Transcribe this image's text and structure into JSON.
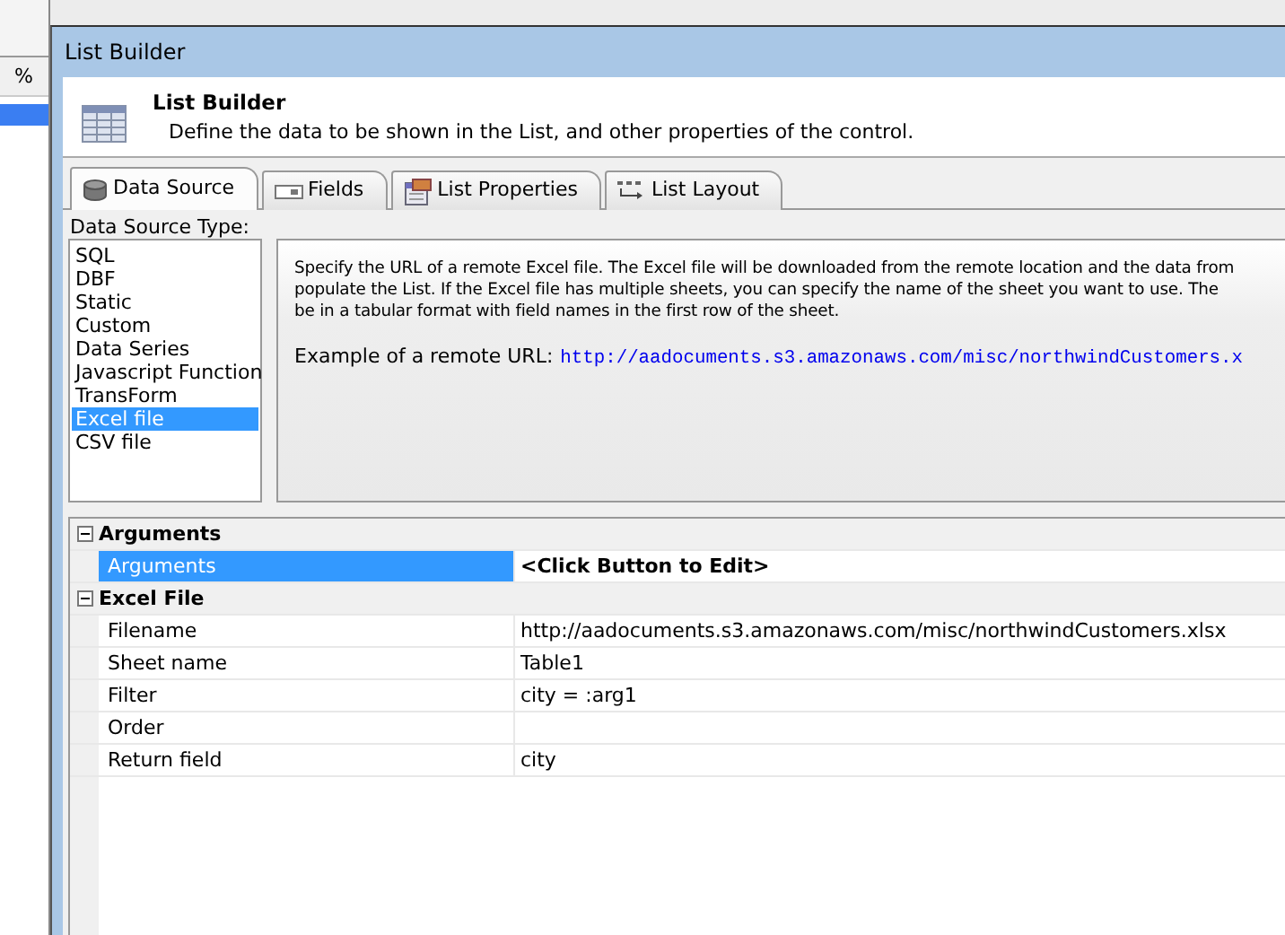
{
  "background_app": {
    "column_header": "%"
  },
  "window": {
    "title": "List Builder"
  },
  "header": {
    "title": "List Builder",
    "subtitle": "Define the data to be shown in the List, and other properties of the control."
  },
  "tabs": [
    {
      "label": "Data Source",
      "kind": "database",
      "selected": true
    },
    {
      "label": "Fields",
      "kind": "fields",
      "selected": false
    },
    {
      "label": "List Properties",
      "kind": "properties",
      "selected": false
    },
    {
      "label": "List Layout",
      "kind": "layout",
      "selected": false
    }
  ],
  "data_source_type": {
    "label": "Data Source Type:",
    "items": [
      {
        "label": "SQL",
        "selected": false
      },
      {
        "label": "DBF",
        "selected": false
      },
      {
        "label": "Static",
        "selected": false
      },
      {
        "label": "Custom",
        "selected": false
      },
      {
        "label": "Data Series",
        "selected": false
      },
      {
        "label": "Javascript Function",
        "selected": false
      },
      {
        "label": "TransForm",
        "selected": false
      },
      {
        "label": "Excel file",
        "selected": true
      },
      {
        "label": "CSV file",
        "selected": false
      }
    ]
  },
  "description": {
    "lines": [
      "Specify the URL of a remote Excel file. The Excel file will be downloaded from the remote location and the data from",
      "populate the List. If the Excel file has multiple sheets, you can specify the name of the sheet you want to use. The",
      "be in a tabular format with field names in the first row of the sheet."
    ],
    "example_label": "Example of a remote URL:",
    "example_url": "http://aadocuments.s3.amazonaws.com/misc/northwindCustomers.x"
  },
  "property_grid": {
    "groups": [
      {
        "title": "Arguments",
        "expanded": true,
        "rows": [
          {
            "name": "Arguments",
            "value": "<Click Button to Edit>",
            "kind": "prompt",
            "selected": true
          }
        ]
      },
      {
        "title": "Excel File",
        "expanded": true,
        "rows": [
          {
            "name": "Filename",
            "value": "http://aadocuments.s3.amazonaws.com/misc/northwindCustomers.xlsx",
            "kind": "text",
            "selected": false
          },
          {
            "name": "Sheet name",
            "value": "Table1",
            "kind": "text",
            "selected": false
          },
          {
            "name": "Filter",
            "value": "city = :arg1",
            "kind": "text",
            "selected": false
          },
          {
            "name": "Order",
            "kind": "text",
            "selected": false
          },
          {
            "name": "Return field",
            "value": "city",
            "kind": "text",
            "selected": false
          }
        ]
      }
    ]
  }
}
